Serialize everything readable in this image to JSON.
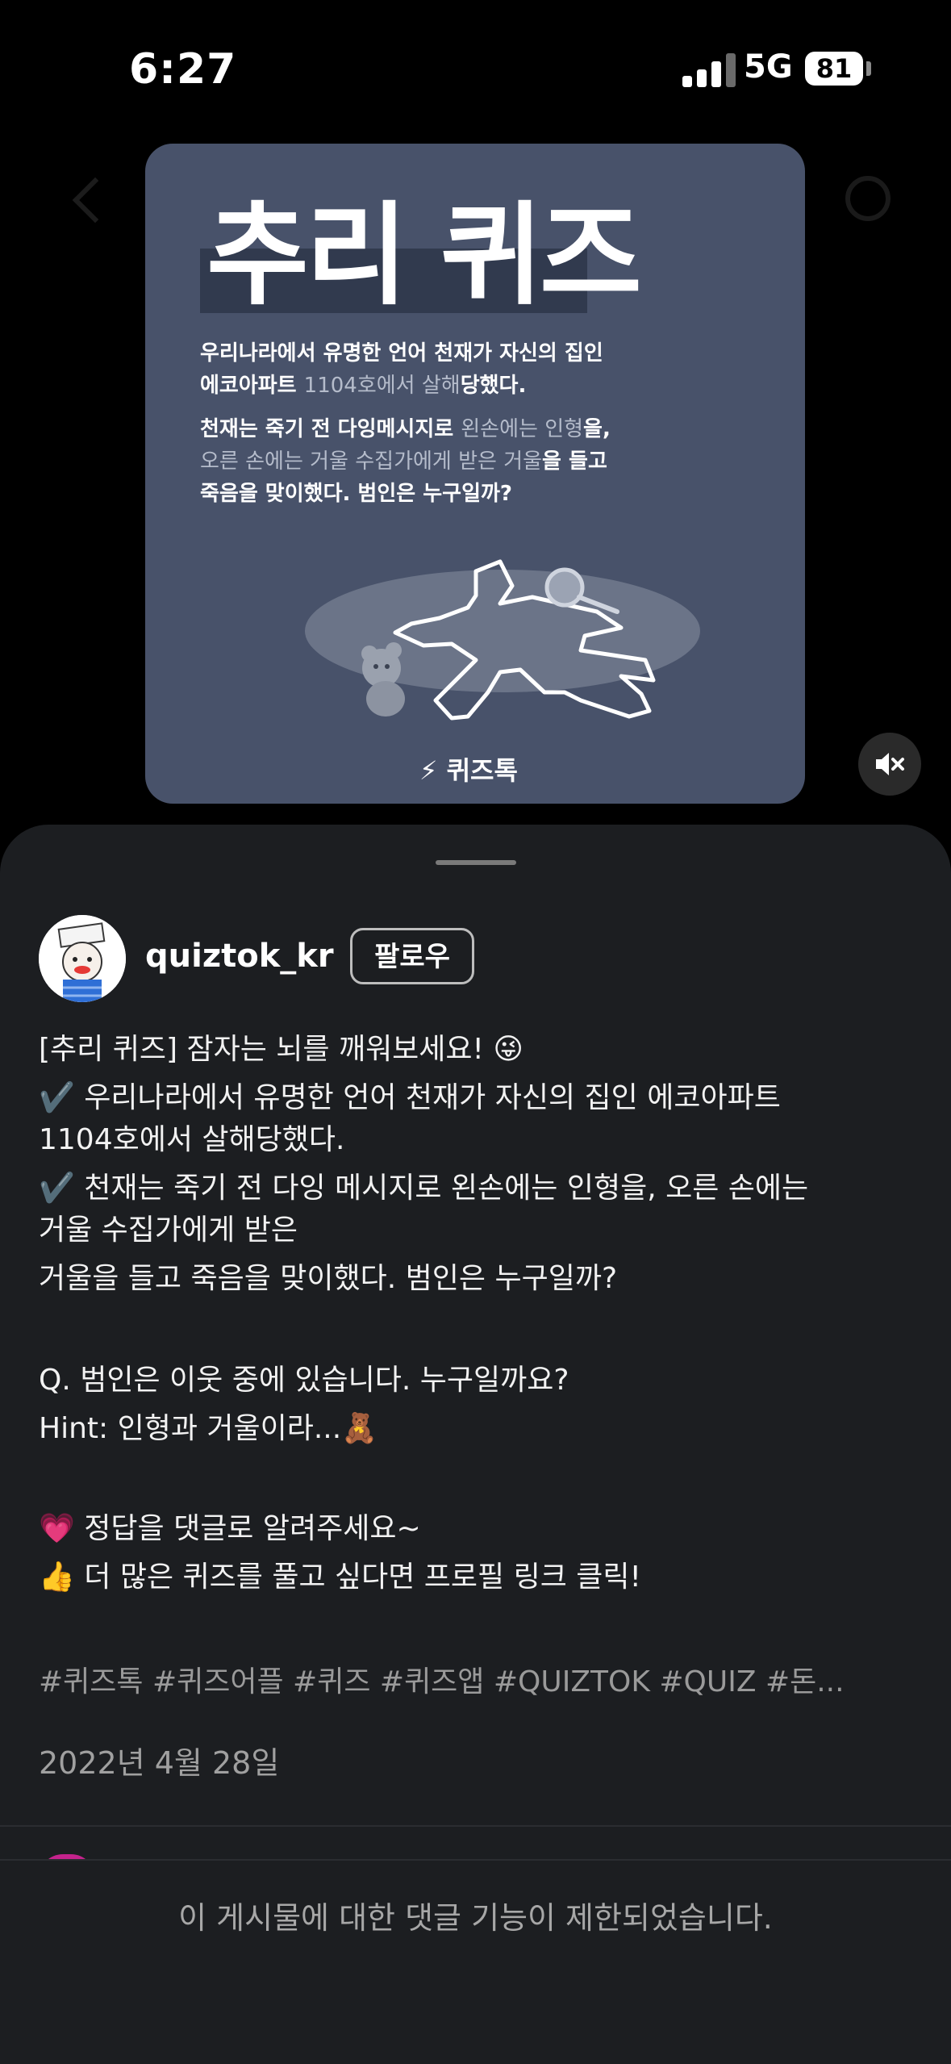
{
  "status_bar": {
    "time": "6:27",
    "network": "5G",
    "battery": "81"
  },
  "media": {
    "title": "추리 퀴즈",
    "line1": "우리나라에서 유명한 언어 천재가 자신의 집인",
    "line2a": "에코아파트 ",
    "line2b": "1104호에서 살해",
    "line2c": "당했다.",
    "line3a": "천재는 죽기 전 다잉메시지로 ",
    "line3b": "왼손에는 인형",
    "line3c": "을,",
    "line4a": "오른 손에는 거울 수집가에게 받은 거울",
    "line4b": "을 들고",
    "line5": "죽음을 맞이했다. 범인은 누구일까?",
    "logo": "퀴즈톡",
    "background_color": "#48526a"
  },
  "post": {
    "username": "quiztok_kr",
    "follow_label": "팔로우",
    "caption": [
      "[추리 퀴즈] 잠자는 뇌를 깨워보세요! 😜",
      "✔️ 우리나라에서 유명한 언어 천재가 자신의 집인 에코아파트",
      "1104호에서 살해당했다.",
      "✔️ 천재는 죽기 전 다잉 메시지로 왼손에는 인형을, 오른 손에는",
      "거울 수집가에게 받은",
      "거울을 들고 죽음을 맞이했다. 범인은 누구일까?",
      "Q. 범인은 이웃 중에 있습니다. 누구일까요?",
      "Hint: 인형과 거울이라...🧸",
      "💗 정답을 댓글로 알려주세요~",
      "👍 더 많은 퀴즈를 풀고 싶다면 프로필 링크 클릭!"
    ],
    "hashtags": "#퀴즈톡 #퀴즈어플 #퀴즈 #퀴즈앱 #QUIZTOK #QUIZ #돈...",
    "date": "2022년 4월 28일"
  },
  "footer": {
    "comments_disabled": "이 게시물에 대한 댓글 기능이 제한되었습니다."
  },
  "icons": {
    "mute": "speaker-muted-icon",
    "back": "chevron-left-icon",
    "search": "search-icon"
  }
}
